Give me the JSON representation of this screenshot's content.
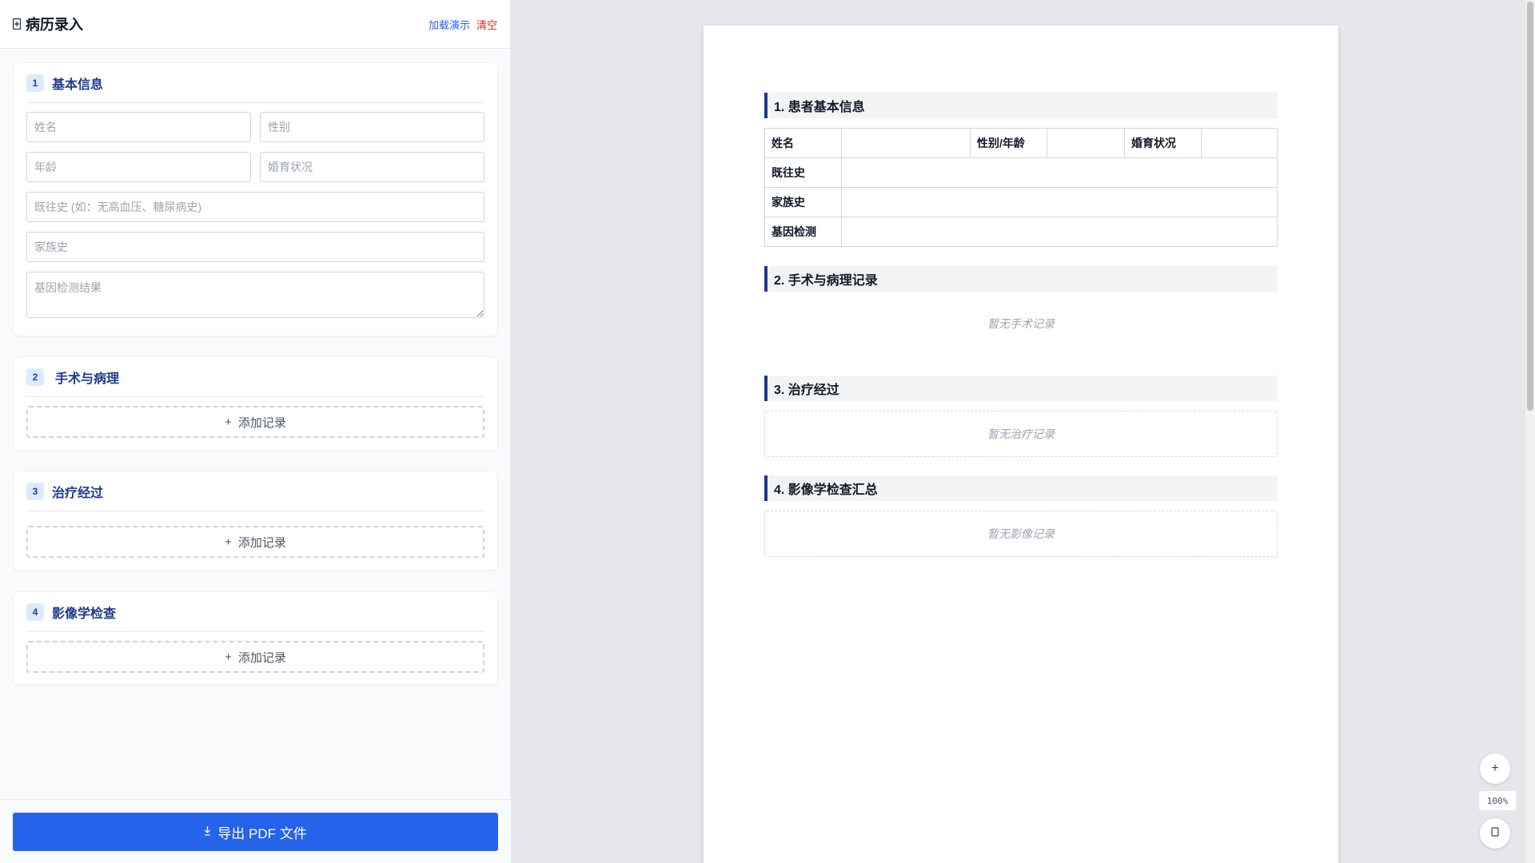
{
  "sidebar": {
    "icon": "file-medical-icon",
    "title": "病历录入",
    "load_demo": "加载演示",
    "clear": "清空",
    "sections": {
      "basic": {
        "number": "1",
        "title": "基本信息",
        "name_placeholder": "姓名",
        "gender_placeholder": "性别",
        "age_placeholder": "年龄",
        "marital_placeholder": "婚育状况",
        "history_placeholder": "既往史 (如：无高血压、糖尿病史)",
        "family_placeholder": "家族史",
        "gene_placeholder": "基因检测结果"
      },
      "surgery": {
        "number": "2",
        "title": "手术与病理",
        "add_label": "添加记录"
      },
      "treatment": {
        "number": "3",
        "title": "治疗经过",
        "add_label": "添加记录"
      },
      "imaging": {
        "number": "4",
        "title": "影像学检查",
        "add_label": "添加记录"
      }
    },
    "export_label": "导出 PDF 文件"
  },
  "preview": {
    "sec1_title": "1. 患者基本信息",
    "table": {
      "name": "姓名",
      "gender_age": "性别/年龄",
      "marital": "婚育状况",
      "history": "既往史",
      "family": "家族史",
      "gene": "基因检测"
    },
    "sec2_title": "2. 手术与病理记录",
    "sec2_empty": "暂无手术记录",
    "sec3_title": "3. 治疗经过",
    "sec3_empty": "暂无治疗记录",
    "sec4_title": "4. 影像学检查汇总",
    "sec4_empty": "暂无影像记录"
  },
  "zoom": {
    "plus": "+",
    "level": "100%",
    "reset_icon": "fit-screen-icon"
  },
  "colors": {
    "primary": "#2563eb",
    "heading": "#1e3a8a",
    "danger": "#dc2626"
  }
}
